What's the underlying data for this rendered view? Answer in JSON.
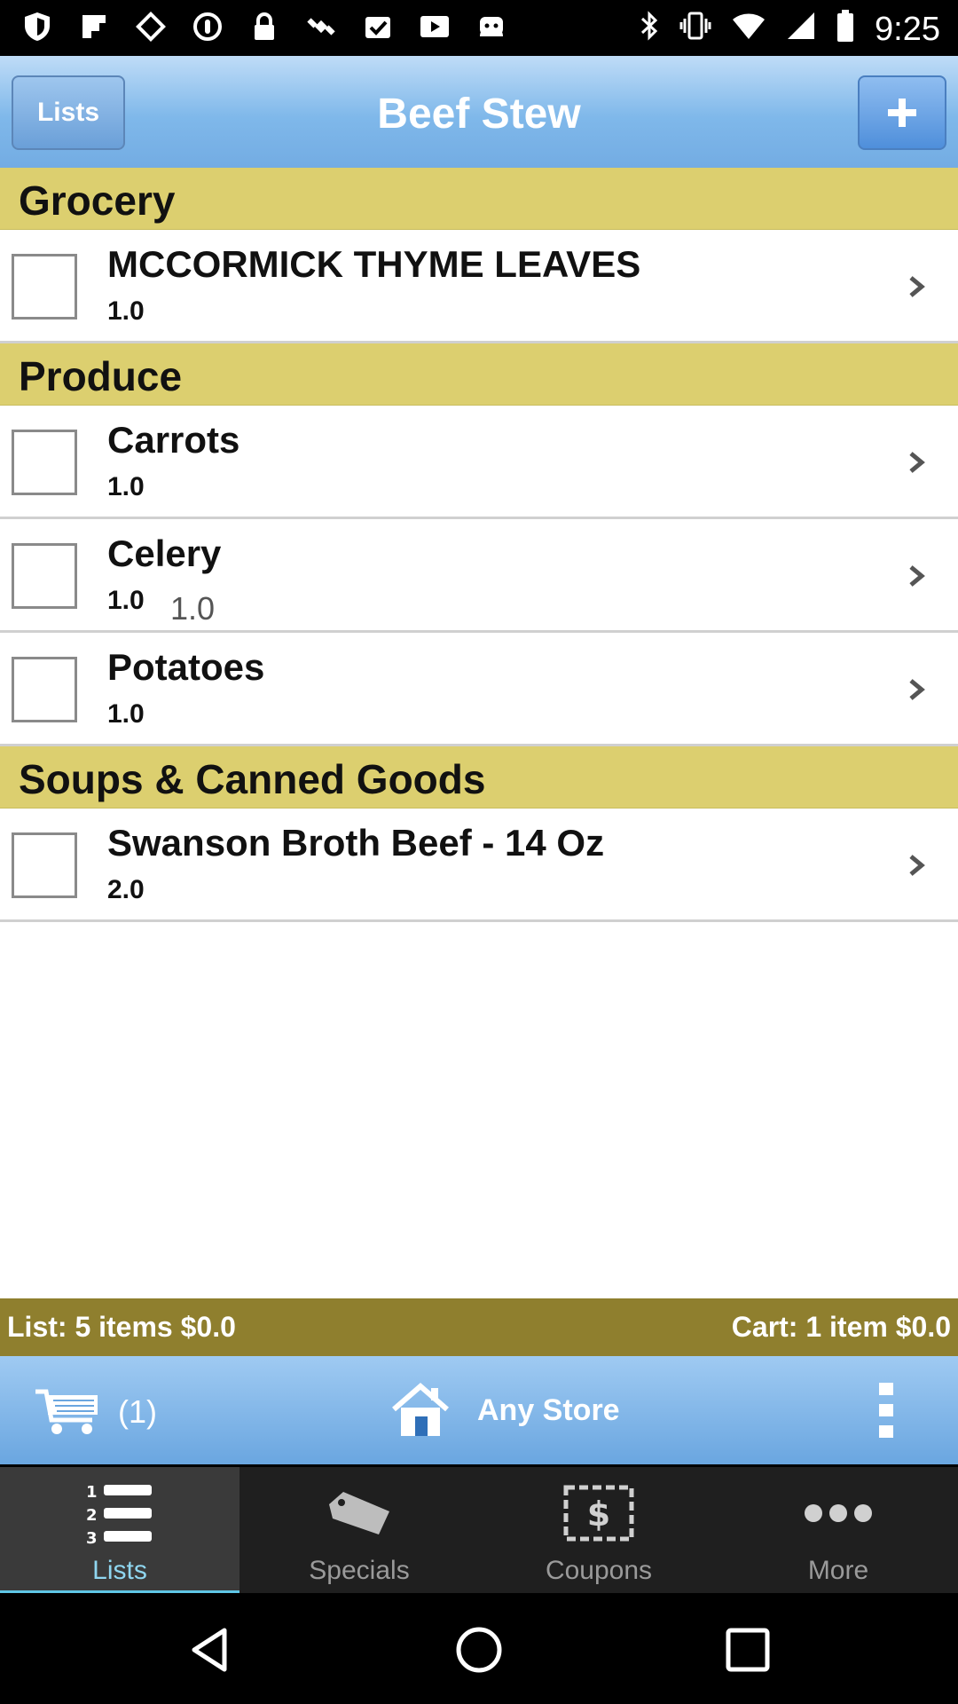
{
  "status_bar": {
    "time": "9:25",
    "left_icons": [
      "shield-icon",
      "flipboard-icon",
      "diamond-icon",
      "record-icon",
      "lock-icon",
      "satellite-icon",
      "check-icon",
      "play-icon",
      "android-icon"
    ],
    "right_icons": [
      "bluetooth-icon",
      "vibrate-icon",
      "wifi-icon",
      "signal-icon",
      "battery-icon"
    ]
  },
  "header": {
    "lists_button": "Lists",
    "title": "Beef Stew",
    "add_button": "+"
  },
  "sections": [
    {
      "title": "Grocery",
      "items": [
        {
          "name": "MCCORMICK THYME LEAVES",
          "qty": "1.0",
          "price": ""
        }
      ]
    },
    {
      "title": "Produce",
      "items": [
        {
          "name": "Carrots",
          "qty": "1.0",
          "price": ""
        },
        {
          "name": "Celery",
          "qty": "1.0",
          "price": "1.0"
        },
        {
          "name": "Potatoes",
          "qty": "1.0",
          "price": ""
        }
      ]
    },
    {
      "title": "Soups & Canned Goods",
      "items": [
        {
          "name": "Swanson Broth Beef - 14 Oz",
          "qty": "2.0",
          "price": ""
        }
      ]
    }
  ],
  "summary": {
    "list_text": "List: 5 items $0.0",
    "cart_text": "Cart: 1 item $0.0"
  },
  "store_bar": {
    "cart_count": "(1)",
    "store_name": "Any Store"
  },
  "tabs": [
    {
      "label": "Lists",
      "icon": "numbered-list-icon",
      "active": true
    },
    {
      "label": "Specials",
      "icon": "price-tag-icon",
      "active": false
    },
    {
      "label": "Coupons",
      "icon": "dollar-coupon-icon",
      "active": false
    },
    {
      "label": "More",
      "icon": "more-dots-icon",
      "active": false
    }
  ],
  "colors": {
    "header_blue": "#7fb8ea",
    "section_yellow": "#dccf6f",
    "summary_olive": "#8f7f2e",
    "active_tab_accent": "#5fc7e6"
  }
}
